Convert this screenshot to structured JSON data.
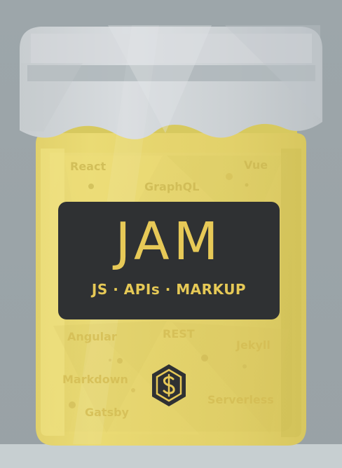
{
  "brand": {
    "title": "JAM",
    "subtitle": "JS · APIs · MARKUP"
  },
  "technologies": {
    "react": "React",
    "vue": "Vue",
    "graphql": "GraphQL",
    "angular": "Angular",
    "rest": "REST",
    "jekyll": "Jekyll",
    "markdown": "Markdown",
    "gatsby": "Gatsby",
    "serverless": "Serverless"
  },
  "icons": {
    "logo": "dollar-sign-hexagon-icon",
    "jar": "jar-icon"
  },
  "colors": {
    "background": "#9da6aa",
    "jar_fill": "#e3d36c",
    "label_panel": "#2f3133",
    "label_text": "#e7c957",
    "lid_cloth": "#d5d9dc"
  }
}
